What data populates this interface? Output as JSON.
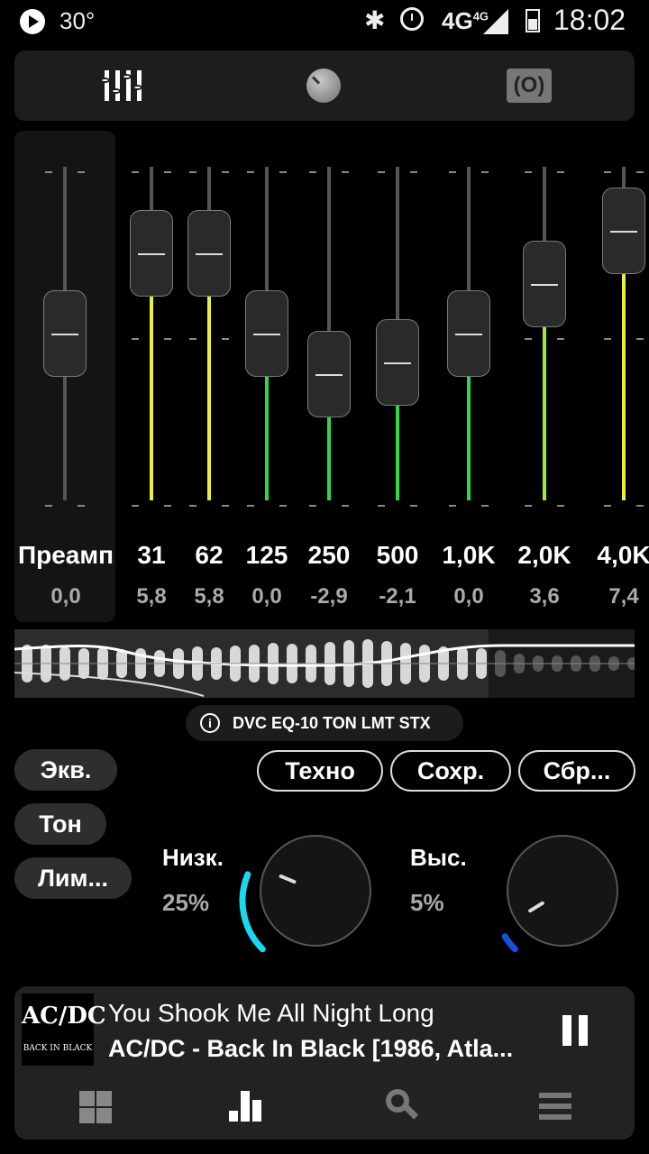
{
  "status_bar": {
    "temperature": "30°",
    "network": "4G",
    "network_sup": "4G",
    "time": "18:02"
  },
  "tabs": {
    "equalizer_icon": "equalizer-sliders-icon",
    "tone_icon": "tone-knob-icon",
    "limiter_icon": "limiter-icon",
    "limiter_glyph": "(O)"
  },
  "equalizer": {
    "preamp": {
      "label": "Преамп",
      "value": "0,0",
      "level": 0.0
    },
    "bands": [
      {
        "freq": "31",
        "value": "5,8",
        "gain": 5.8
      },
      {
        "freq": "62",
        "value": "5,8",
        "gain": 5.8
      },
      {
        "freq": "125",
        "value": "0,0",
        "gain": 0.0
      },
      {
        "freq": "250",
        "value": "-2,9",
        "gain": -2.9
      },
      {
        "freq": "500",
        "value": "-2,1",
        "gain": -2.1
      },
      {
        "freq": "1,0K",
        "value": "0,0",
        "gain": 0.0
      },
      {
        "freq": "2,0K",
        "value": "3,6",
        "gain": 3.6
      },
      {
        "freq": "4,0K",
        "value": "7,4",
        "gain": 7.4
      }
    ],
    "range_db": [
      -12,
      12
    ]
  },
  "preset_tag": {
    "text": "DVC EQ-10 TON LMT STX"
  },
  "side_buttons": {
    "eq": "Экв.",
    "tone": "Тон",
    "limiter": "Лим..."
  },
  "preset_buttons": {
    "preset": "Техно",
    "save": "Сохр.",
    "reset": "Сбр..."
  },
  "tone": {
    "bass": {
      "label": "Низк.",
      "value": "25%",
      "level": 0.25
    },
    "treble": {
      "label": "Выс.",
      "value": "5%",
      "level": 0.05
    },
    "colors": {
      "bass_arc": "#1ad8f0",
      "treble_arc": "#1a4fe0"
    }
  },
  "player": {
    "cover_logo": "AC/DC",
    "cover_subtitle": "BACK IN BLACK",
    "title": "You Shook Me All Night Long",
    "artist": "AC/DC - Back In Black [1986, Atla..."
  }
}
